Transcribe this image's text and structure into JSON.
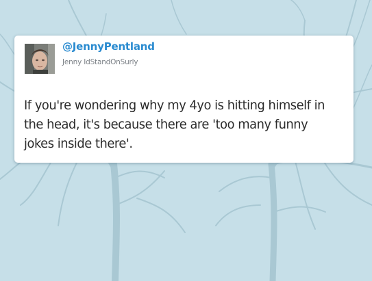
{
  "tweet": {
    "handle": "@JennyPentland",
    "display_name": "Jenny IdStandOnSurly",
    "text": "If you're wondering why my 4yo is hitting himself in the head, it's because there are 'too many funny jokes inside there'.",
    "avatar_icon": "profile-photo"
  },
  "colors": {
    "background": "#c6dfe8",
    "handle": "#2a8bd0",
    "text": "#2b2b2b",
    "subtext": "#7b8086"
  }
}
